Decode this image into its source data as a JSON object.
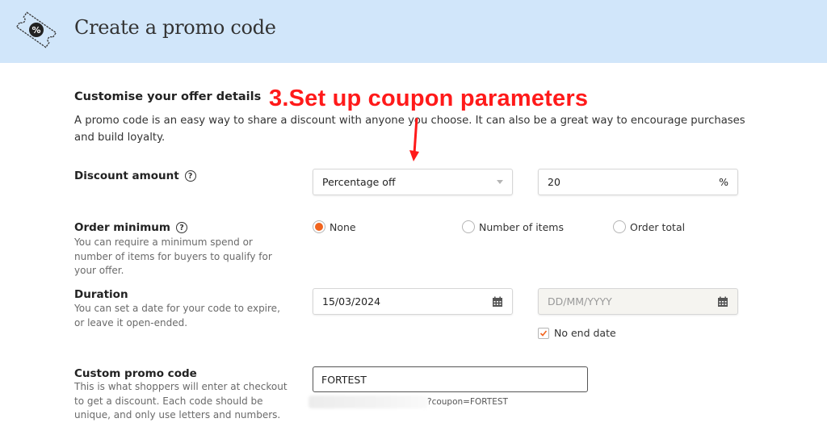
{
  "header": {
    "title": "Create a promo code",
    "icon": "promo-ticket-icon"
  },
  "section": {
    "title": "Customise your offer details",
    "description": "A promo code is an easy way to share a discount with anyone you choose. It can also be a great way to encourage purchases and build loyalty."
  },
  "annotation": {
    "text": "3.Set up coupon parameters",
    "color": "#ff1a1a"
  },
  "discount": {
    "label": "Discount amount",
    "help_icon": "question-circle-icon",
    "type_selected": "Percentage off",
    "amount_value": "20",
    "amount_suffix": "%"
  },
  "order_minimum": {
    "label": "Order minimum",
    "help_icon": "question-circle-icon",
    "help": "You can require a minimum spend or number of items for buyers to qualify for your offer.",
    "options": [
      {
        "label": "None",
        "checked": true
      },
      {
        "label": "Number of items",
        "checked": false
      },
      {
        "label": "Order total",
        "checked": false
      }
    ]
  },
  "duration": {
    "label": "Duration",
    "help": "You can set a date for your code to expire, or leave it open-ended.",
    "start_value": "15/03/2024",
    "end_placeholder": "DD/MM/YYYY",
    "no_end_date_label": "No end date",
    "no_end_date_checked": true,
    "calendar_icon": "calendar-icon"
  },
  "custom_code": {
    "label": "Custom promo code",
    "help": "This is what shoppers will enter at checkout to get a discount. Each code should be unique, and only use letters and numbers.",
    "value": "FORTEST",
    "url_suffix": "?coupon=FORTEST"
  },
  "colors": {
    "header_bg": "#d1e6fa",
    "accent": "#f1641e"
  }
}
